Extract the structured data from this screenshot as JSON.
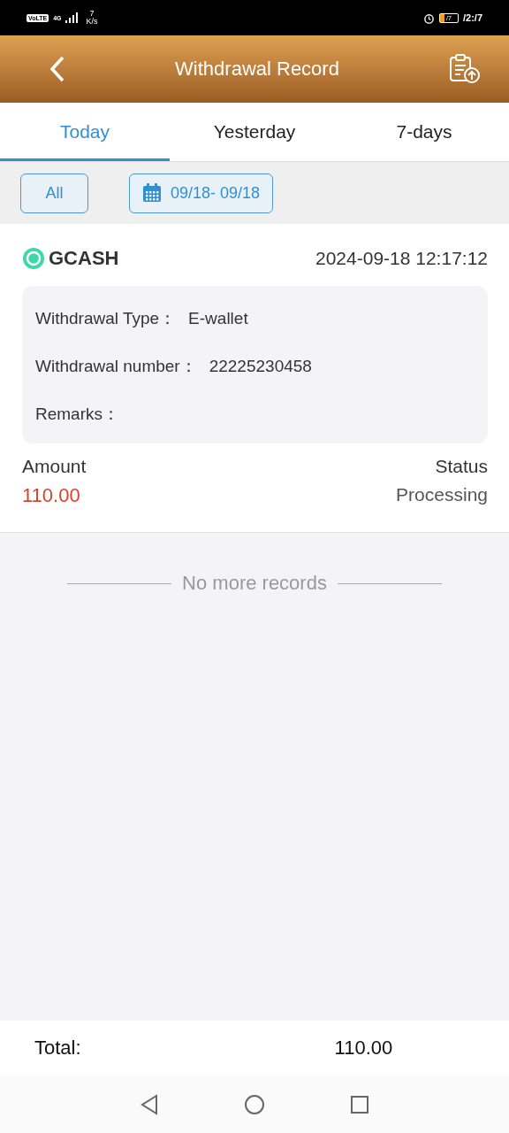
{
  "status_bar": {
    "volte": "VoLTE",
    "network": "4G",
    "speed_value": "7",
    "speed_unit": "K/s",
    "battery": "/7",
    "time": "/2:/7"
  },
  "header": {
    "title": "Withdrawal Record"
  },
  "tabs": [
    {
      "label": "Today",
      "selected": true
    },
    {
      "label": "Yesterday",
      "selected": false
    },
    {
      "label": "7-days",
      "selected": false
    }
  ],
  "filters": {
    "type_button": "All",
    "date_range": "09/18- 09/18"
  },
  "records": [
    {
      "method": "GCASH",
      "datetime": "2024-09-18 12:17:12",
      "details": [
        {
          "label": "Withdrawal Type：",
          "value": "E-wallet"
        },
        {
          "label": "Withdrawal number：",
          "value": "22225230458"
        },
        {
          "label": "Remarks："
        }
      ],
      "amount_label": "Amount",
      "amount": "110.00",
      "status_label": "Status",
      "status": "Processing"
    }
  ],
  "end_message": "No more records",
  "footer": {
    "total_label": "Total:",
    "total": "110.00"
  }
}
